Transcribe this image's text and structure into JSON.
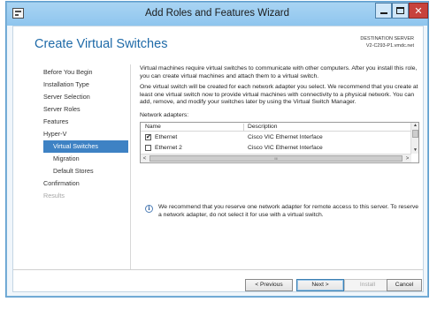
{
  "window": {
    "title": "Add Roles and Features Wizard"
  },
  "header": {
    "page_title": "Create Virtual Switches",
    "destination_label": "DESTINATION SERVER",
    "destination_server": "V2-C293-P1.vmdc.net"
  },
  "nav": {
    "items": [
      {
        "label": "Before You Begin",
        "state": "normal"
      },
      {
        "label": "Installation Type",
        "state": "normal"
      },
      {
        "label": "Server Selection",
        "state": "normal"
      },
      {
        "label": "Server Roles",
        "state": "normal"
      },
      {
        "label": "Features",
        "state": "normal"
      },
      {
        "label": "Hyper-V",
        "state": "normal"
      },
      {
        "label": "Virtual Switches",
        "state": "selected"
      },
      {
        "label": "Migration",
        "state": "sub"
      },
      {
        "label": "Default Stores",
        "state": "sub"
      },
      {
        "label": "Confirmation",
        "state": "normal"
      },
      {
        "label": "Results",
        "state": "disabled"
      }
    ]
  },
  "content": {
    "para1": "Virtual machines require virtual switches to communicate with other computers. After you install this role, you can create virtual machines and attach them to a virtual switch.",
    "para2": "One virtual switch will be created for each network adapter you select. We recommend that you create at least one virtual switch now to provide virtual machines with connectivity to a physical network. You can add, remove, and modify your switches later by using the Virtual Switch Manager.",
    "adapters_label": "Network adapters:",
    "table": {
      "columns": [
        "Name",
        "Description"
      ],
      "rows": [
        {
          "name": "Ethernet",
          "description": "Cisco VIC Ethernet Interface",
          "checked": true
        },
        {
          "name": "Ethernet 2",
          "description": "Cisco VIC Ethernet Interface",
          "checked": false
        }
      ],
      "scroll_up": "▲",
      "scroll_down": "▼",
      "scroll_left": "<",
      "scroll_right": ">",
      "thumb_grip": "III"
    },
    "info_icon_glyph": "i",
    "info_text": "We recommend that you reserve one network adapter for remote access to this server. To reserve a network adapter, do not select it for use with a virtual switch."
  },
  "buttons": {
    "previous": "< Previous",
    "next": "Next >",
    "install": "Install",
    "cancel": "Cancel"
  },
  "colors": {
    "accent": "#3e82c4",
    "title_blue": "#1e6aa8",
    "close_red": "#c7423c"
  }
}
